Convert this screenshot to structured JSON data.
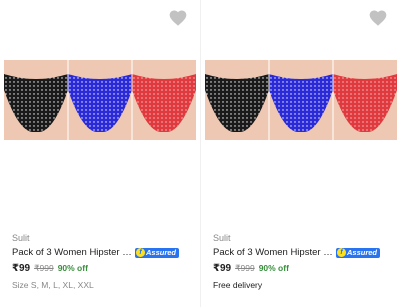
{
  "products": [
    {
      "brand": "Sulit",
      "title": "Pack of 3 Women Hipster Mult...",
      "assured": "Assured",
      "price": "₹99",
      "mrp": "₹999",
      "discount": "90% off",
      "extra": "Size S, M, L, XL, XXL"
    },
    {
      "brand": "Sulit",
      "title": "Pack of 3 Women Hipster Mult...",
      "assured": "Assured",
      "price": "₹99",
      "mrp": "₹999",
      "discount": "90% off",
      "extra": "Free delivery"
    }
  ],
  "colors": {
    "panty_black": "#1a1a1a",
    "panty_blue": "#2a2ad8",
    "panty_red": "#e03a3e",
    "skin": "#efc8b4"
  }
}
